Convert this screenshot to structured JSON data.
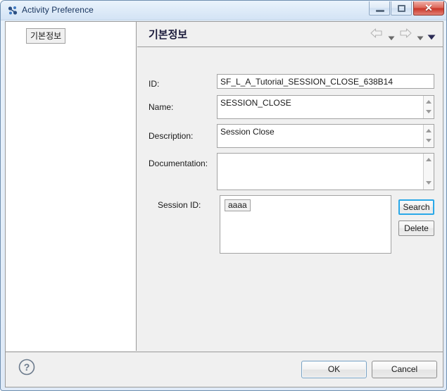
{
  "window": {
    "title": "Activity Preference",
    "icon": "activity-preference-icon",
    "minimize_label": "–",
    "maximize_label": "□",
    "close_label": "✕"
  },
  "sidebar": {
    "items": [
      {
        "label": "기본정보",
        "name": "tree-item-basic-info"
      }
    ]
  },
  "pane": {
    "title": "기본정보",
    "nav": {
      "back": "back-arrow-icon",
      "back_dropdown": "chevron-down-icon",
      "forward": "forward-arrow-icon",
      "forward_dropdown": "chevron-down-icon",
      "menu": "view-menu-icon"
    }
  },
  "form": {
    "fields": [
      {
        "label": "ID:",
        "value": "SF_L_A_Tutorial_SESSION_CLOSE_638B14",
        "placeholder": ""
      },
      {
        "label": "Name:",
        "value": "SESSION_CLOSE",
        "placeholder": ""
      },
      {
        "label": "Description:",
        "value": "Session Close",
        "placeholder": ""
      },
      {
        "label": "Documentation:",
        "value": "",
        "placeholder": ""
      },
      {
        "label": "Session ID:",
        "value": "",
        "placeholder": ""
      }
    ],
    "session_items": [
      {
        "label": "aaaa"
      }
    ],
    "buttons": {
      "search": "Search",
      "delete": "Delete"
    }
  },
  "footer": {
    "help": "?",
    "ok": "OK",
    "cancel": "Cancel"
  },
  "colors": {
    "titlebar_text": "#15325c",
    "close_button": "#c9382a",
    "focus_ring": "#2aa8e8",
    "pane_title": "#1c1c3c",
    "menu_triangle": "#2b2b55"
  }
}
